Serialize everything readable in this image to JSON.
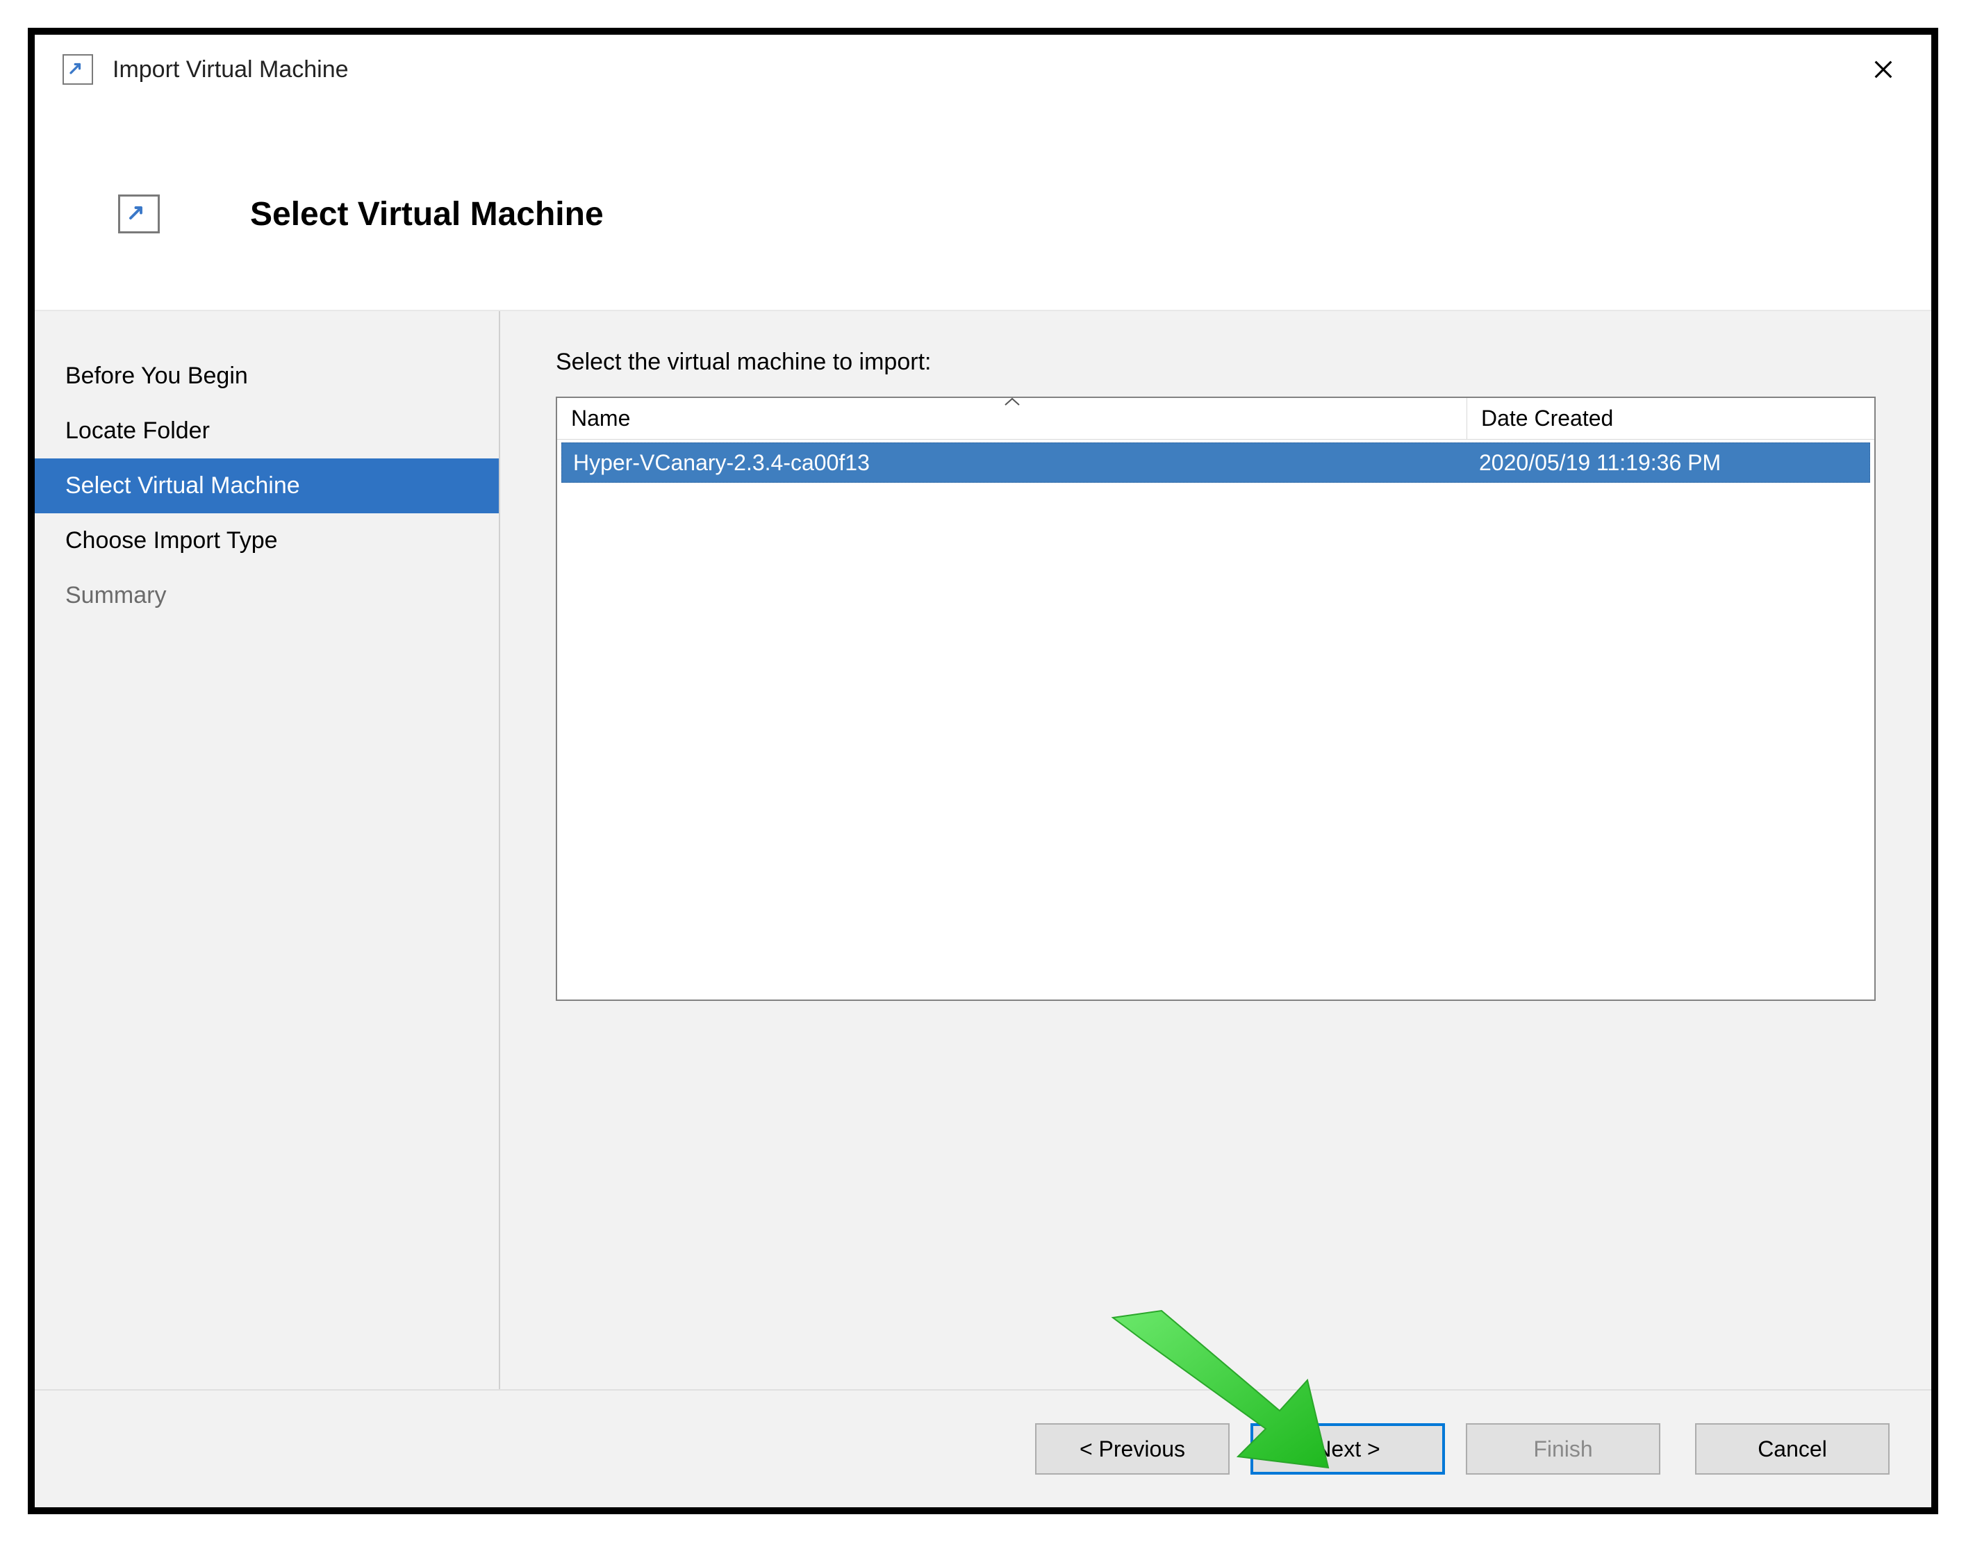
{
  "window": {
    "title": "Import Virtual Machine"
  },
  "page": {
    "heading": "Select Virtual Machine",
    "prompt": "Select the virtual machine to import:"
  },
  "steps": [
    {
      "label": "Before You Begin",
      "state": "normal"
    },
    {
      "label": "Locate Folder",
      "state": "normal"
    },
    {
      "label": "Select Virtual Machine",
      "state": "selected"
    },
    {
      "label": "Choose Import Type",
      "state": "normal"
    },
    {
      "label": "Summary",
      "state": "disabled"
    }
  ],
  "list": {
    "columns": {
      "name": "Name",
      "date": "Date Created"
    },
    "sort_column": "name",
    "sort_direction": "asc",
    "rows": [
      {
        "name": "Hyper-VCanary-2.3.4-ca00f13",
        "date": "2020/05/19 11:19:36 PM",
        "selected": true
      }
    ]
  },
  "buttons": {
    "previous": "< Previous",
    "next": "Next >",
    "finish": "Finish",
    "cancel": "Cancel"
  },
  "colors": {
    "selection_blue": "#2f73c3",
    "row_selection": "#3f7ebf",
    "primary_button_border": "#0078d7",
    "annotation_arrow": "#37d337"
  }
}
